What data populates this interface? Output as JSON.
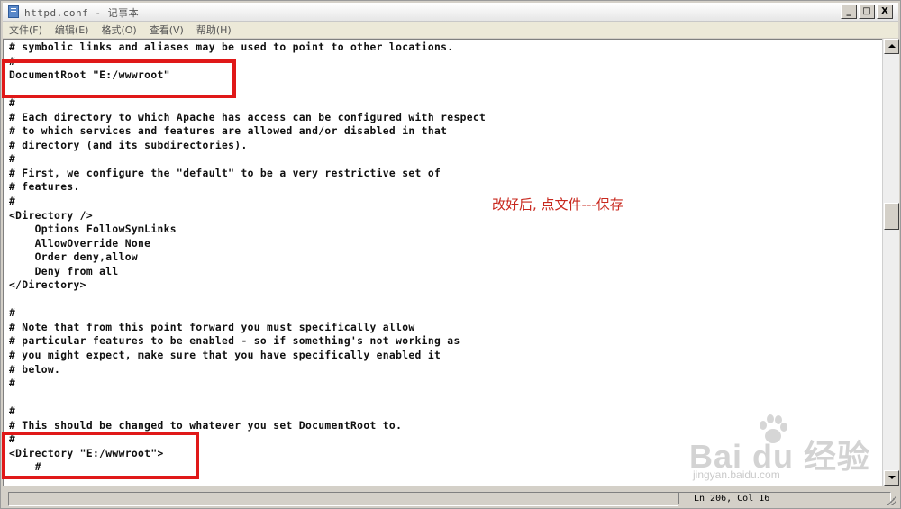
{
  "window": {
    "title": "httpd.conf - 记事本",
    "minimize": "_",
    "maximize": "□",
    "close": "X"
  },
  "menu": [
    "文件(F)",
    "编辑(E)",
    "格式(O)",
    "查看(V)",
    "帮助(H)"
  ],
  "editor": {
    "lines": [
      "# symbolic links and aliases may be used to point to other locations.",
      "#",
      "DocumentRoot \"E:/wwwroot\"",
      "",
      "#",
      "# Each directory to which Apache has access can be configured with respect",
      "# to which services and features are allowed and/or disabled in that",
      "# directory (and its subdirectories).",
      "#",
      "# First, we configure the \"default\" to be a very restrictive set of",
      "# features.",
      "#",
      "<Directory />",
      "    Options FollowSymLinks",
      "    AllowOverride None",
      "    Order deny,allow",
      "    Deny from all",
      "</Directory>",
      "",
      "#",
      "# Note that from this point forward you must specifically allow",
      "# particular features to be enabled - so if something's not working as",
      "# you might expect, make sure that you have specifically enabled it",
      "# below.",
      "#",
      "",
      "#",
      "# This should be changed to whatever you set DocumentRoot to.",
      "#",
      "<Directory \"E:/wwwroot\">",
      "    #"
    ]
  },
  "status": {
    "position": "Ln 206, Col 16"
  },
  "annotation": {
    "text": "改好后, 点文件---保存",
    "color": "#c8281e"
  },
  "watermark": {
    "brand": "Bai du 经验",
    "url": "jingyan.baidu.com"
  },
  "colors": {
    "highlight_border": "#e01818"
  }
}
